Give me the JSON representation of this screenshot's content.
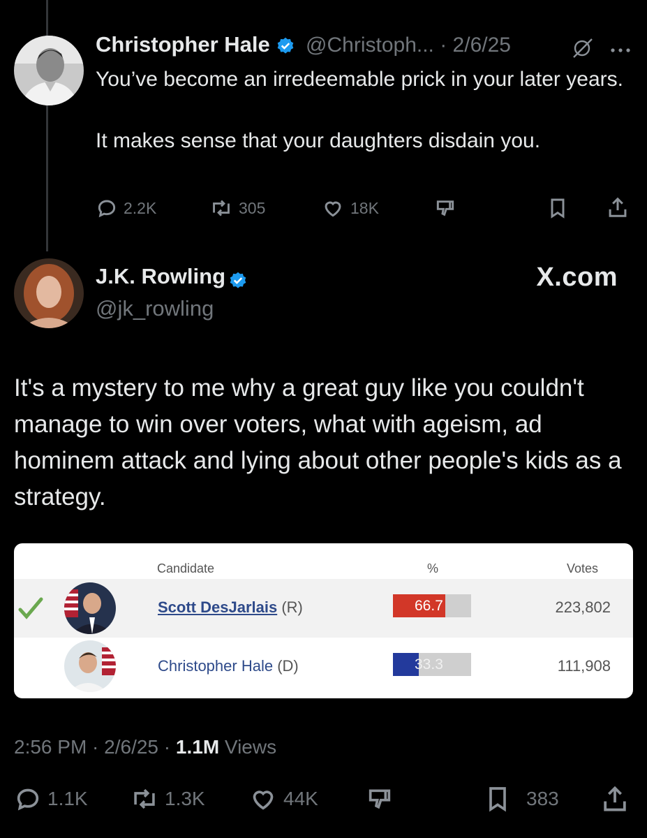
{
  "reply": {
    "name": "Christopher Hale",
    "handle": "@Christoph... · 2/6/25",
    "paragraphs": [
      "You’ve become an irredeemable prick in your later years.",
      "It makes sense that your daughters disdain you."
    ],
    "stats": {
      "replies": "2.2K",
      "reposts": "305",
      "likes": "18K"
    }
  },
  "post": {
    "name": "J.K. Rowling",
    "handle": "@jk_rowling",
    "watermark": "X.com",
    "text": "It's a mystery to me why a great guy like you couldn't manage to win over voters, what with ageism, ad hominem attack and lying about other people's kids as a strategy.",
    "card": {
      "col_candidate": "Candidate",
      "col_percent": "%",
      "col_votes": "Votes",
      "rows": [
        {
          "name": "Scott DesJarlais",
          "party": "(R)",
          "percent_label": "66.7",
          "percent": 66.7,
          "votes": "223,802",
          "color": "#d23728"
        },
        {
          "name": "Christopher Hale",
          "party": "(D)",
          "percent_label": "33.3",
          "percent": 33.3,
          "votes": "111,908",
          "color": "#233a9c"
        }
      ]
    },
    "meta": {
      "time": "2:56 PM · 2/6/25 · ",
      "views_count": "1.1M",
      "views_label": " Views"
    },
    "stats": {
      "replies": "1.1K",
      "reposts": "1.3K",
      "likes": "44K",
      "bookmarks": "383"
    }
  },
  "colors": {
    "background": "#000000",
    "text": "#e7e9ea",
    "muted": "#71767b",
    "verified": "#1d9bf0",
    "checkmark": "#6aa84f"
  }
}
